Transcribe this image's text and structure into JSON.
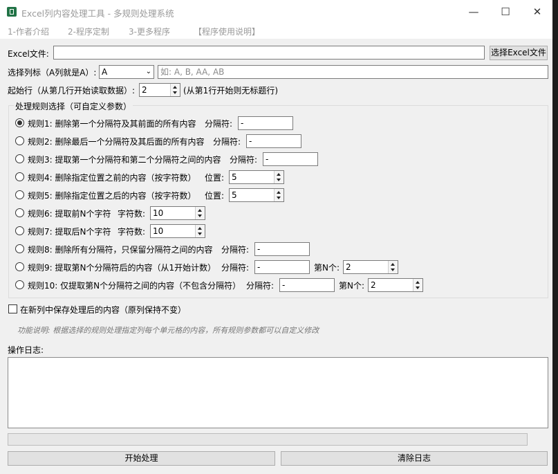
{
  "window": {
    "title": "Excel列内容处理工具 - 多规则处理系统",
    "minimize": "—",
    "maximize": "☐",
    "close": "✕"
  },
  "menu": [
    "1-作者介绍",
    "2-程序定制",
    "3-更多程序",
    "【程序使用说明】"
  ],
  "file": {
    "label": "Excel文件:",
    "value": "",
    "button": "选择Excel文件"
  },
  "column": {
    "label": "选择列标（A列就是A）:",
    "selected": "A",
    "placeholder": "如: A, B, AA, AB"
  },
  "start_row": {
    "label": "起始行（从第几行开始读取数据）:",
    "value": "2",
    "note": "(从第1行开始则无标题行)"
  },
  "rules_group": {
    "title": "处理规则选择（可自定义参数）",
    "rules": [
      {
        "label": "规则1: 删除第一个分隔符及其前面的所有内容",
        "param_label": "分隔符:",
        "param": "-",
        "checked": true
      },
      {
        "label": "规则2: 删除最后一个分隔符及其后面的所有内容",
        "param_label": "分隔符:",
        "param": "-"
      },
      {
        "label": "规则3: 提取第一个分隔符和第二个分隔符之间的内容",
        "param_label": "分隔符:",
        "param": "-"
      },
      {
        "label": "规则4: 删除指定位置之前的内容（按字符数）",
        "param_label": "位置:",
        "param": "5"
      },
      {
        "label": "规则5: 删除指定位置之后的内容（按字符数）",
        "param_label": "位置:",
        "param": "5"
      },
      {
        "label": "规则6: 提取前N个字符",
        "param_label": "字符数:",
        "param": "10"
      },
      {
        "label": "规则7: 提取后N个字符",
        "param_label": "字符数:",
        "param": "10"
      },
      {
        "label": "规则8: 删除所有分隔符，只保留分隔符之间的内容",
        "param_label": "分隔符:",
        "param": "-"
      },
      {
        "label": "规则9: 提取第N个分隔符后的内容（从1开始计数）",
        "param_label": "分隔符:",
        "param": "-",
        "param2_label": "第N个:",
        "param2": "2"
      },
      {
        "label": "规则10: 仅提取第N个分隔符之间的内容（不包含分隔符）",
        "param_label": "分隔符:",
        "param": "-",
        "param2_label": "第N个:",
        "param2": "2"
      }
    ]
  },
  "new_column": {
    "label": "在新列中保存处理后的内容（原列保持不变）"
  },
  "description": "功能说明: 根据选择的规则处理指定列每个单元格的内容，所有规则参数都可以自定义修改",
  "log": {
    "label": "操作日志:",
    "value": ""
  },
  "progress": 0,
  "buttons": {
    "start": "开始处理",
    "clear": "清除日志"
  }
}
